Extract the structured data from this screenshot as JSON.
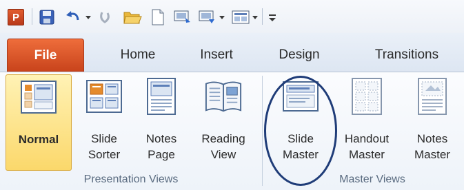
{
  "quick_access_toolbar": {
    "items": [
      {
        "icon": "powerpoint-logo-icon",
        "letter": "P"
      },
      {
        "icon": "save-icon"
      },
      {
        "icon": "undo-icon"
      },
      {
        "icon": "redo-icon"
      },
      {
        "icon": "open-folder-icon"
      },
      {
        "icon": "new-document-icon"
      },
      {
        "icon": "start-slideshow-icon"
      },
      {
        "icon": "slideshow-from-current-icon"
      },
      {
        "icon": "layout-icon"
      },
      {
        "icon": "customize-qat-icon"
      }
    ]
  },
  "tabs": [
    {
      "label": "File",
      "active_style": "file"
    },
    {
      "label": "Home"
    },
    {
      "label": "Insert"
    },
    {
      "label": "Design"
    },
    {
      "label": "Transitions"
    }
  ],
  "groups": [
    {
      "label": "Presentation Views",
      "buttons": [
        {
          "label": "Normal",
          "icon": "normal-view-icon",
          "selected": true
        },
        {
          "label": "Slide\nSorter",
          "icon": "slide-sorter-icon"
        },
        {
          "label": "Notes\nPage",
          "icon": "notes-page-icon"
        },
        {
          "label": "Reading\nView",
          "icon": "reading-view-icon"
        }
      ]
    },
    {
      "label": "Master Views",
      "buttons": [
        {
          "label": "Slide\nMaster",
          "icon": "slide-master-icon",
          "highlighted": true
        },
        {
          "label": "Handout\nMaster",
          "icon": "handout-master-icon"
        },
        {
          "label": "Notes\nMaster",
          "icon": "notes-master-icon"
        }
      ]
    }
  ],
  "colors": {
    "file_tab": "#d7532a",
    "selected_button": "#fbd86b",
    "annotation_ellipse": "#1f3c78"
  }
}
